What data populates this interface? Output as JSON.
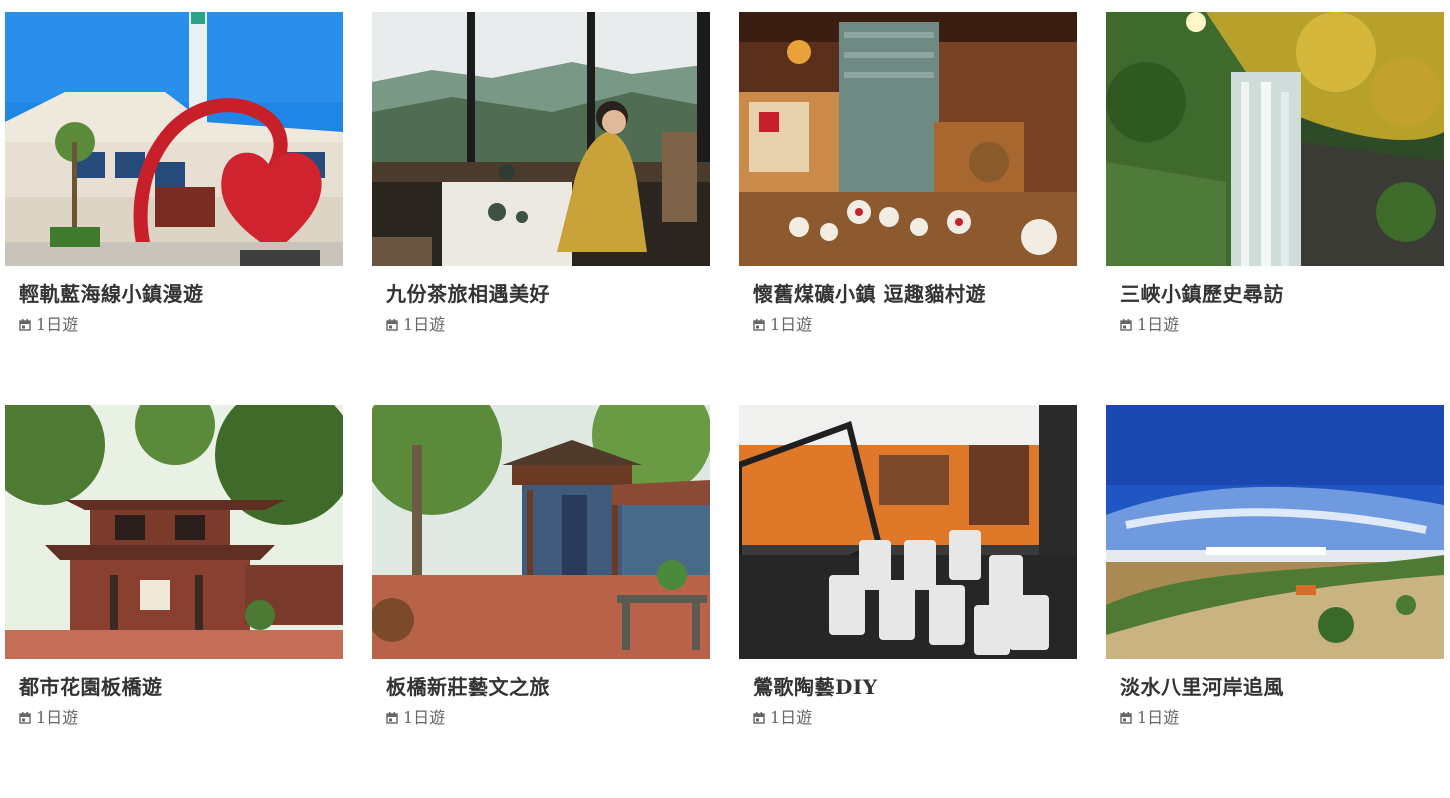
{
  "tours": [
    {
      "title": "輕軌藍海線小鎮漫遊",
      "duration": "1日遊",
      "image": "blue-sea-heart-sculpture"
    },
    {
      "title": "九份茶旅相遇美好",
      "duration": "1日遊",
      "image": "jiufen-teahouse-view"
    },
    {
      "title": "懷舊煤礦小鎮 逗趣貓村遊",
      "duration": "1日遊",
      "image": "lucky-cat-shop"
    },
    {
      "title": "三峽小鎮歷史尋訪",
      "duration": "1日遊",
      "image": "forest-waterfall"
    },
    {
      "title": "都市花園板橋遊",
      "duration": "1日遊",
      "image": "historic-garden-pavilion"
    },
    {
      "title": "板橋新莊藝文之旅",
      "duration": "1日遊",
      "image": "traditional-courtyard"
    },
    {
      "title": "鶯歌陶藝DIY",
      "duration": "1日遊",
      "image": "ceramic-cups-train"
    },
    {
      "title": "淡水八里河岸追風",
      "duration": "1日遊",
      "image": "riverside-park-sky"
    }
  ],
  "icons": {
    "duration": "calendar-icon"
  },
  "colors": {
    "title": "#333333",
    "meta": "#666666"
  }
}
